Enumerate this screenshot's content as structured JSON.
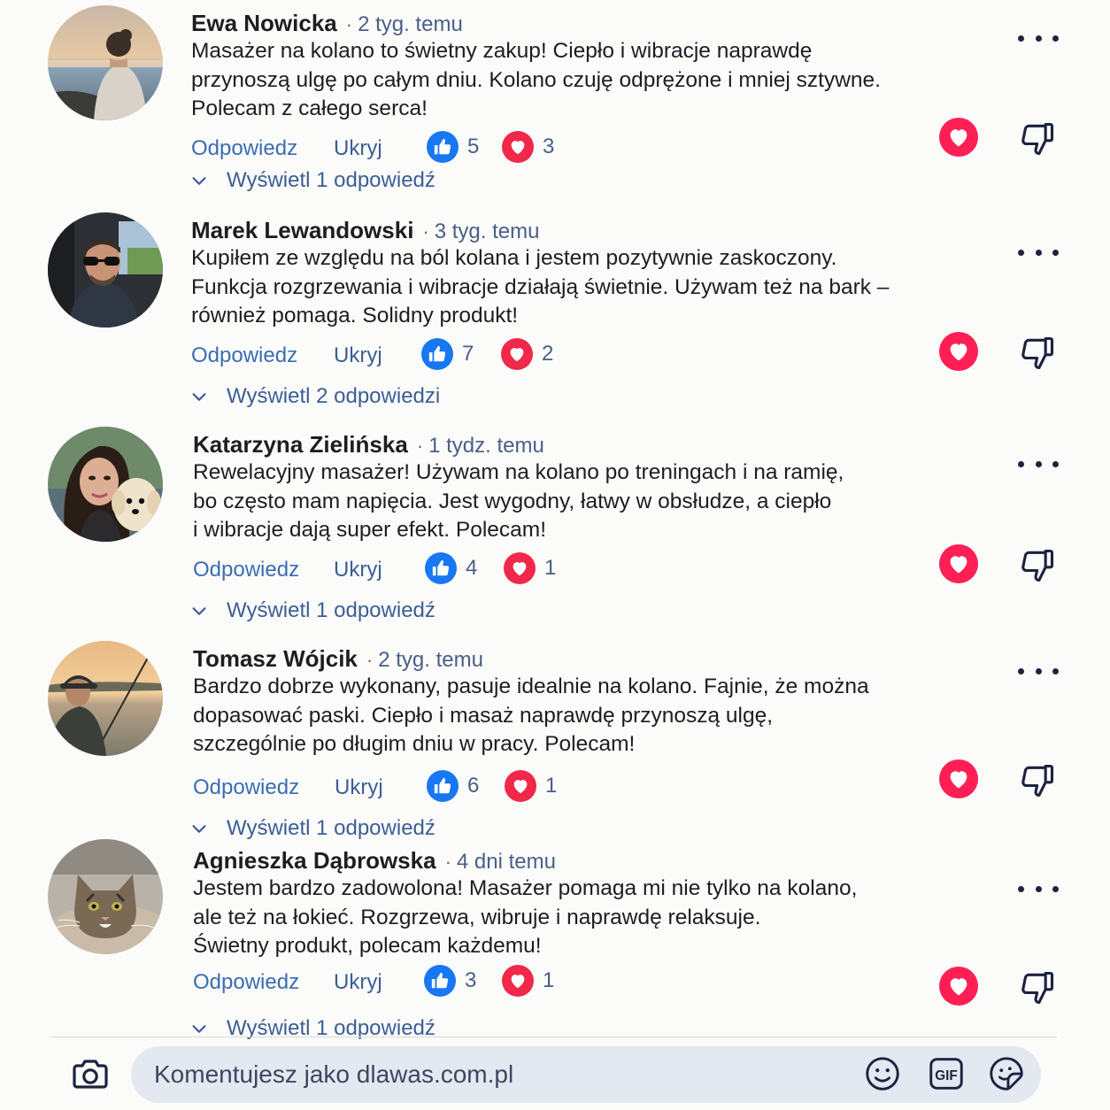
{
  "colors": {
    "like": "#1877f2",
    "heart": "#f02849",
    "accent_heart": "#ff1f55",
    "link": "#3b6db3",
    "time": "#4a5f86"
  },
  "comments": [
    {
      "author": "Ewa Nowicka",
      "separator": "·",
      "time": "2 tyg. temu",
      "lines": [
        "Masażer na kolano to świetny zakup! Ciepło i wibracje naprawdę",
        "przynoszą ulgę po całym dniu. Kolano czuję odprężone i mniej sztywne.",
        "Polecam z całego serca!"
      ],
      "reply_label": "Odpowiedz",
      "hide_label": "Ukryj",
      "likes": "5",
      "hearts": "3",
      "view_replies": "Wyświetl 1 odpowiedź",
      "avatar": "woman-by-sea"
    },
    {
      "author": "Marek Lewandowski",
      "separator": "·",
      "time": "3 tyg. temu",
      "lines": [
        "Kupiłem ze względu na ból kolana i jestem pozytywnie zaskoczony.",
        "Funkcja rozgrzewania i wibracje działają świetnie. Używam też na bark –",
        "również pomaga. Solidny produkt!"
      ],
      "reply_label": "Odpowiedz",
      "hide_label": "Ukryj",
      "likes": "7",
      "hearts": "2",
      "view_replies": "Wyświetl 2 odpowiedzi",
      "avatar": "man-in-car"
    },
    {
      "author": "Katarzyna Zielińska",
      "separator": "·",
      "time": "1 tydz. temu",
      "lines": [
        "Rewelacyjny masażer! Używam na kolano po treningach i na ramię,",
        "bo często mam napięcia. Jest wygodny, łatwy w obsłudze, a ciepło",
        "i wibracje dają super efekt. Polecam!"
      ],
      "reply_label": "Odpowiedz",
      "hide_label": "Ukryj",
      "likes": "4",
      "hearts": "1",
      "view_replies": "Wyświetl 1 odpowiedź",
      "avatar": "woman-with-dog"
    },
    {
      "author": "Tomasz Wójcik",
      "separator": "·",
      "time": "2 tyg. temu",
      "lines": [
        "Bardzo dobrze wykonany, pasuje idealnie na kolano. Fajnie, że można",
        "dopasować paski. Ciepło i masaż naprawdę przynoszą ulgę,",
        "szczególnie po długim dniu w pracy. Polecam!"
      ],
      "reply_label": "Odpowiedz",
      "hide_label": "Ukryj",
      "likes": "6",
      "hearts": "1",
      "view_replies": "Wyświetl 1 odpowiedź",
      "avatar": "man-fishing"
    },
    {
      "author": "Agnieszka Dąbrowska",
      "separator": "·",
      "time": "4 dni temu",
      "lines": [
        "Jestem bardzo zadowolona! Masażer pomaga mi nie tylko na kolano,",
        "ale też na łokieć. Rozgrzewa, wibruje i naprawdę relaksuje.",
        "Świetny produkt, polecam każdemu!"
      ],
      "reply_label": "Odpowiedz",
      "hide_label": "Ukryj",
      "likes": "3",
      "hearts": "1",
      "view_replies": "Wyświetl 1 odpowiedź",
      "avatar": "tabby-cat"
    }
  ],
  "composer": {
    "placeholder": "Komentujesz jako dlawas.com.pl",
    "gif_label": "GIF",
    "icons": [
      "camera-icon",
      "emoji-icon",
      "gif-icon",
      "sticker-icon"
    ]
  }
}
